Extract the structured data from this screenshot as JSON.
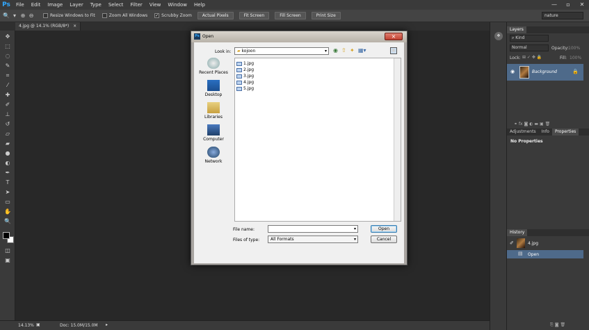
{
  "app": {
    "logo": "Ps",
    "menu": [
      "File",
      "Edit",
      "Image",
      "Layer",
      "Type",
      "Select",
      "Filter",
      "View",
      "Window",
      "Help"
    ],
    "window_controls": [
      "—",
      "▫",
      "✕"
    ]
  },
  "options_bar": {
    "resize_label": "Resize Windows to Fit",
    "zoom_all_label": "Zoom All Windows",
    "scrubby_label": "Scrubby Zoom",
    "buttons": [
      "Actual Pixels",
      "Fit Screen",
      "Fill Screen",
      "Print Size"
    ],
    "workspace": "nature"
  },
  "document": {
    "tab_label": "4.jpg @ 14.1% (RGB/8*)",
    "tab_close": "×"
  },
  "status": {
    "zoom": "14.13%",
    "doc": "Doc: 15.0M/15.0M"
  },
  "layers_panel": {
    "tab": "Layers",
    "kind": "Kind",
    "blend_mode": "Normal",
    "opacity_label": "Opacity:",
    "opacity": "100%",
    "lock_label": "Lock:",
    "fill_label": "Fill:",
    "fill": "100%",
    "layer_name": "Background"
  },
  "properties_panel": {
    "tabs": [
      "Adjustments",
      "Info",
      "Properties"
    ],
    "message": "No Properties"
  },
  "history_panel": {
    "tab": "History",
    "snapshot": "4.jpg",
    "step": "Open"
  },
  "dialog": {
    "title": "Open",
    "look_in_label": "Look in:",
    "look_in_value": "kojoon",
    "places": [
      "Recent Places",
      "Desktop",
      "Libraries",
      "Computer",
      "Network"
    ],
    "files": [
      "1.jpg",
      "2.jpg",
      "3.jpg",
      "4.jpg",
      "5.jpg"
    ],
    "file_name_label": "File name:",
    "file_name_value": "",
    "files_of_type_label": "Files of type:",
    "files_of_type_value": "All Formats",
    "open_button": "Open",
    "cancel_button": "Cancel"
  },
  "colors": {
    "accent": "#31a8ff",
    "selected_row": "#4e6a8a"
  }
}
